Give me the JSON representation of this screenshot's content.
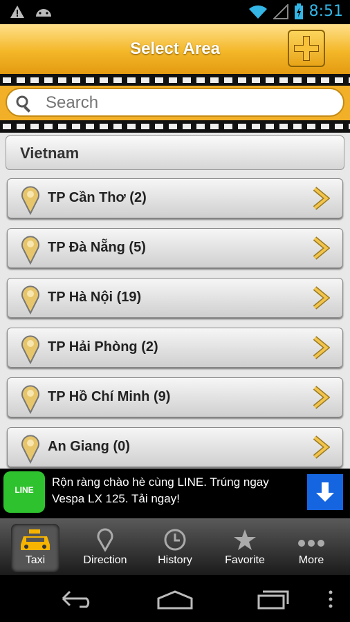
{
  "status": {
    "time": "8:51"
  },
  "header": {
    "title": "Select Area",
    "add_button": "plus-icon"
  },
  "search": {
    "placeholder": "Search",
    "value": ""
  },
  "section": {
    "title": "Vietnam"
  },
  "areas": [
    {
      "label": "TP Cần Thơ (2)"
    },
    {
      "label": "TP Đà Nẵng (5)"
    },
    {
      "label": "TP Hà Nội (19)"
    },
    {
      "label": "TP Hải Phòng (2)"
    },
    {
      "label": "TP Hồ Chí Minh (9)"
    },
    {
      "label": "An Giang (0)"
    }
  ],
  "ad": {
    "logo": "LINE",
    "text": "Rộn ràng chào hè cùng LINE. Trúng ngay Vespa LX 125. Tải ngay!"
  },
  "tabs": [
    {
      "label": "Taxi",
      "icon": "taxi-icon"
    },
    {
      "label": "Direction",
      "icon": "pin-icon"
    },
    {
      "label": "History",
      "icon": "clock-icon"
    },
    {
      "label": "Favorite",
      "icon": "star-icon"
    },
    {
      "label": "More",
      "icon": "more-icon"
    }
  ],
  "colors": {
    "accent": "#f2b028",
    "status": "#33b5e5"
  }
}
